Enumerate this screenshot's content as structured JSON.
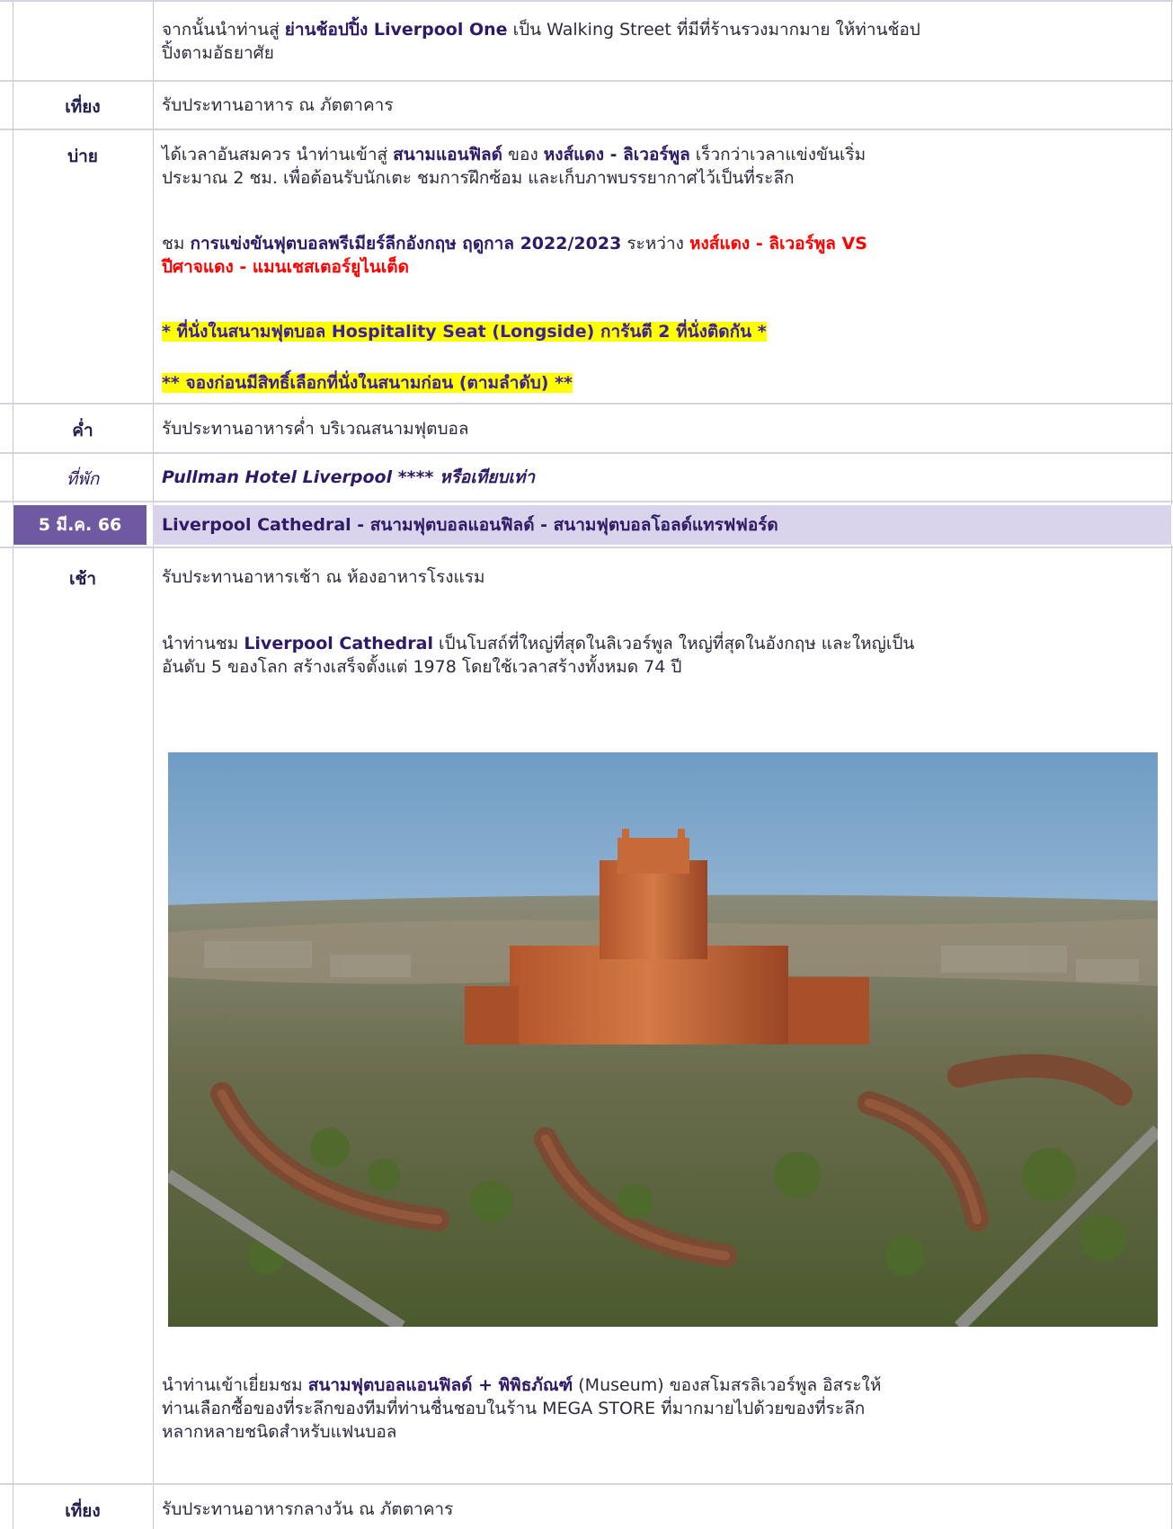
{
  "shopping": {
    "pre": "จากนั้นนำท่านสู่ ",
    "bold": "ย่านช้อปปิ้ง Liverpool One",
    "post1": " เป็น Walking Street ที่มีที่ร้านรวงมากมาย ให้ท่านช้อป",
    "post2": "ปิ้งตามอัธยาศัย"
  },
  "lunch1": {
    "label": "เที่ยง",
    "text": "รับประทานอาหาร ณ ภัตตาคาร"
  },
  "afternoon": {
    "label": "บ่าย",
    "p1_pre": "ได้เวลาอันสมควร นำท่านเข้าสู่ ",
    "p1_bold1": "สนามแอนฟิลด์",
    "p1_mid": " ของ ",
    "p1_bold2": "หงส์แดง - ลิเวอร์พูล",
    "p1_post": " เร็วกว่าเวลาแข่งขันเริ่ม",
    "p1_line2": "ประมาณ 2 ชม. เพื่อต้อนรับนักเตะ ชมการฝึกซ้อม และเก็บภาพบรรยากาศไว้เป็นที่ระลึก",
    "p2_pre": "ชม ",
    "p2_bold": "การแข่งขันฟุตบอลพรีเมียร์ลีกอังกฤษ ฤดูกาล 2022/2023",
    "p2_mid": " ระหว่าง ",
    "p2_red1": "หงส์แดง - ลิเวอร์พูล VS",
    "p2_red2": "ปีศาจแดง - แมนเชสเตอร์ยูไนเต็ด",
    "seat_note": "* ที่นั่งในสนามฟุตบอล Hospitality Seat (Longside) การันตี 2 ที่นั่งติดกัน *",
    "booking_note": "** จองก่อนมีสิทธิ์เลือกที่นั่งในสนามก่อน (ตามลำดับ) **"
  },
  "dinner": {
    "label": "ค่ำ",
    "text": "รับประทานอาหารค่ำ บริเวณสนามฟุตบอล"
  },
  "hotel": {
    "label": "ที่พัก",
    "text": "Pullman Hotel Liverpool  **** หรือเทียบเท่า"
  },
  "day": {
    "date": "5 มี.ค. 66",
    "title": "Liverpool Cathedral - สนามฟุตบอลแอนฟิลด์ - สนามฟุตบอลโอลด์แทรฟฟอร์ด"
  },
  "morning": {
    "label": "เช้า",
    "text": "รับประทานอาหารเช้า ณ ห้องอาหารโรงแรม",
    "cath_pre": "นำท่านชม ",
    "cath_bold": "Liverpool Cathedral",
    "cath_post": " เป็นโบสถ์ที่ใหญ่ที่สุดในลิเวอร์พูล ใหญ่ที่สุดในอังกฤษ และใหญ่เป็น",
    "cath_line2": "อันดับ 5 ของโลก สร้างเสร็จตั้งแต่ 1978 โดยใช้เวลาสร้างทั้งหมด 74 ปี",
    "visit_pre": "นำท่านเข้าเยี่ยมชม ",
    "visit_bold": "สนามฟุตบอลแอนฟิลด์ + พิพิธภัณฑ์",
    "visit_post": " (Museum) ของสโมสรลิเวอร์พูล อิสระให้",
    "visit_line2": "ท่านเลือกซื้อของที่ระลึกของทีมที่ท่านชื่นชอบในร้าน MEGA STORE ที่มากมายไปด้วยของที่ระลึก",
    "visit_line3": "หลากหลายชนิดสำหรับแฟนบอล"
  },
  "lunch2": {
    "label": "เที่ยง",
    "text": "รับประทานอาหารกลางวัน ณ ภัตตาคาร"
  }
}
